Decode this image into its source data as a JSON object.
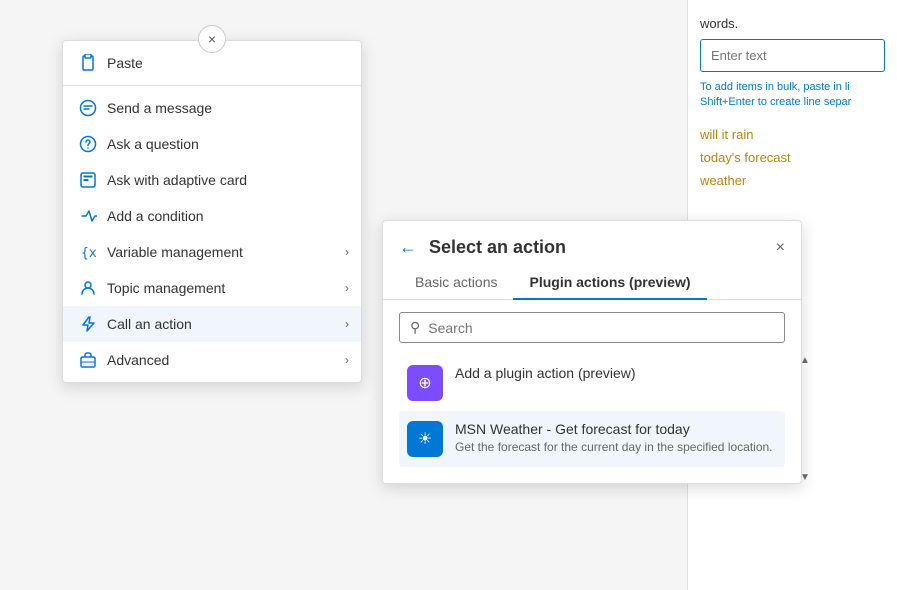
{
  "rightPanel": {
    "words_label": "words.",
    "input_placeholder": "Enter text",
    "hint_line1": "To add items in bulk, paste in li",
    "hint_line2": "Shift+Enter to create line separ",
    "tag1": "will it rain",
    "tag2": "today's forecast",
    "tag3": "weather"
  },
  "contextMenu": {
    "close_icon": "×",
    "items": [
      {
        "id": "paste",
        "label": "Paste",
        "icon": "paste",
        "hasArrow": false
      },
      {
        "id": "send-message",
        "label": "Send a message",
        "icon": "message",
        "hasArrow": false
      },
      {
        "id": "ask-question",
        "label": "Ask a question",
        "icon": "question",
        "hasArrow": false
      },
      {
        "id": "ask-adaptive",
        "label": "Ask with adaptive card",
        "icon": "adaptive",
        "hasArrow": false
      },
      {
        "id": "add-condition",
        "label": "Add a condition",
        "icon": "condition",
        "hasArrow": false
      },
      {
        "id": "variable",
        "label": "Variable management",
        "icon": "variable",
        "hasArrow": true
      },
      {
        "id": "topic",
        "label": "Topic management",
        "icon": "topic",
        "hasArrow": true
      },
      {
        "id": "call-action",
        "label": "Call an action",
        "icon": "lightning",
        "hasArrow": true
      },
      {
        "id": "advanced",
        "label": "Advanced",
        "icon": "briefcase",
        "hasArrow": true
      }
    ]
  },
  "actionPanel": {
    "title": "Select an action",
    "back_label": "←",
    "close_label": "×",
    "tabs": [
      {
        "id": "basic",
        "label": "Basic actions",
        "active": false
      },
      {
        "id": "plugin",
        "label": "Plugin actions (preview)",
        "active": true
      }
    ],
    "search_placeholder": "Search",
    "items": [
      {
        "id": "add-plugin",
        "icon_type": "purple",
        "icon_symbol": "⊕",
        "title": "Add a plugin action (preview)",
        "description": ""
      },
      {
        "id": "msn-weather",
        "icon_type": "blue",
        "icon_symbol": "☀",
        "title": "MSN Weather - Get forecast for today",
        "description": "Get the forecast for the current day in the specified location."
      }
    ],
    "scroll_up": "▲",
    "scroll_down": "▼"
  }
}
